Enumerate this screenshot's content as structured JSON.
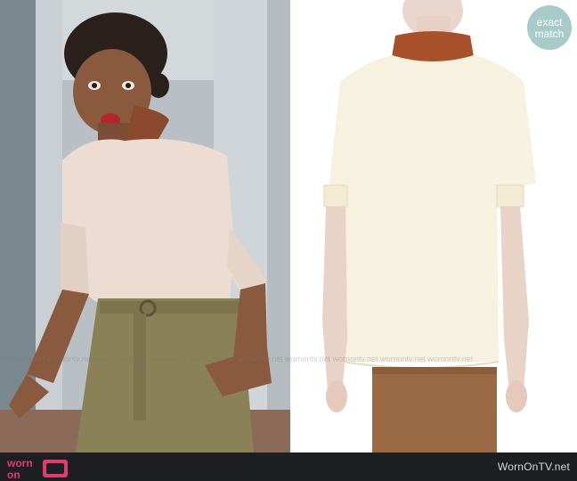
{
  "badge": {
    "line1": "exact",
    "line2": "match"
  },
  "footer": {
    "logo_text_top": "worn",
    "logo_text_bottom": "on",
    "site": "WornOnTV.net"
  },
  "watermark": "wornontv.net   wornontv.net   wornontv.net   wornontv.net   wornontv.net   wornontv.net   wornontv.net   wornontv.net   wornontv.net   wornontv.net"
}
